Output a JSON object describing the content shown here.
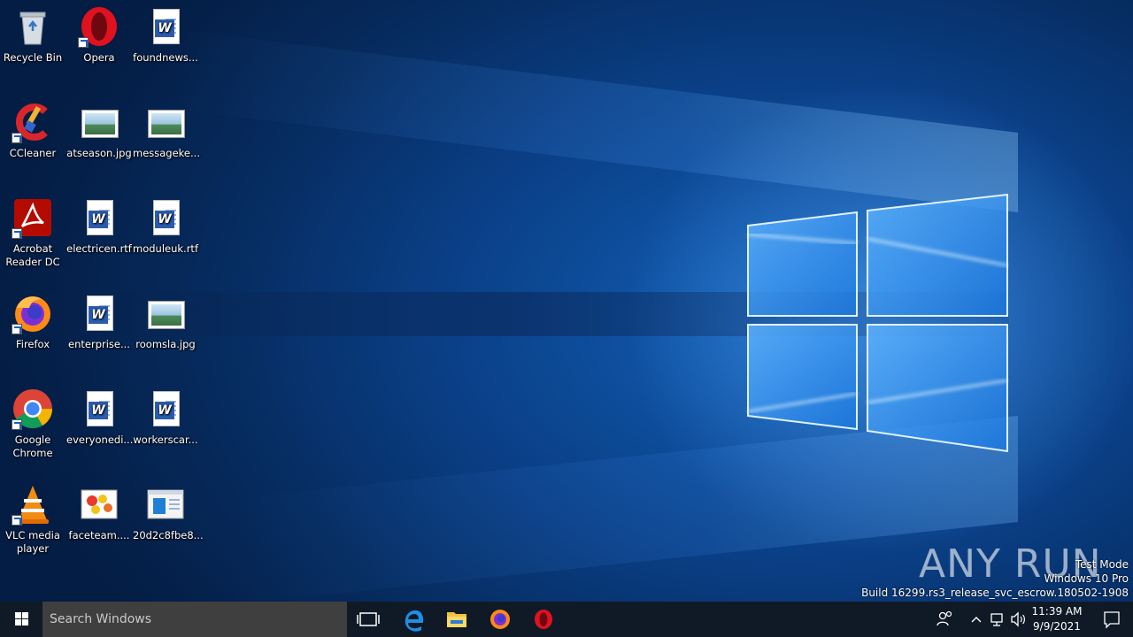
{
  "desktop": {
    "icons": [
      {
        "label": "Recycle Bin",
        "icon": "recycle-bin-icon"
      },
      {
        "label": "Opera",
        "icon": "opera-icon"
      },
      {
        "label": "foundnews...",
        "icon": "word-document-icon"
      },
      {
        "label": "CCleaner",
        "icon": "ccleaner-icon"
      },
      {
        "label": "atseason.jpg",
        "icon": "image-file-icon"
      },
      {
        "label": "messageke...",
        "icon": "image-file-icon"
      },
      {
        "label": "Acrobat Reader DC",
        "icon": "acrobat-icon"
      },
      {
        "label": "electricen.rtf",
        "icon": "word-document-icon"
      },
      {
        "label": "moduleuk.rtf",
        "icon": "word-document-icon"
      },
      {
        "label": "Firefox",
        "icon": "firefox-icon"
      },
      {
        "label": "enterprise...",
        "icon": "word-document-icon"
      },
      {
        "label": "roomsla.jpg",
        "icon": "image-file-icon"
      },
      {
        "label": "Google Chrome",
        "icon": "chrome-icon"
      },
      {
        "label": "everyonedi...",
        "icon": "word-document-icon"
      },
      {
        "label": "workerscar...",
        "icon": "word-document-icon"
      },
      {
        "label": "VLC media player",
        "icon": "vlc-icon"
      },
      {
        "label": "faceteam....",
        "icon": "image-file-icon"
      },
      {
        "label": "20d2c8fbe8...",
        "icon": "executable-icon"
      }
    ]
  },
  "taskbar": {
    "search_placeholder": "Search Windows",
    "pinned": [
      "task-view-icon",
      "edge-icon",
      "file-explorer-icon",
      "firefox-icon",
      "opera-icon"
    ],
    "clock_time": "11:39 AM",
    "clock_date": "9/9/2021"
  },
  "watermark": {
    "brand": "ANY RUN",
    "line1": "Test Mode",
    "line2": "Windows 10 Pro",
    "line3": "Build 16299.rs3_release_svc_escrow.180502-1908"
  },
  "colors": {
    "taskbar": "#101a26",
    "search_bg": "#3f3f3f",
    "accent": "#0078d7"
  }
}
